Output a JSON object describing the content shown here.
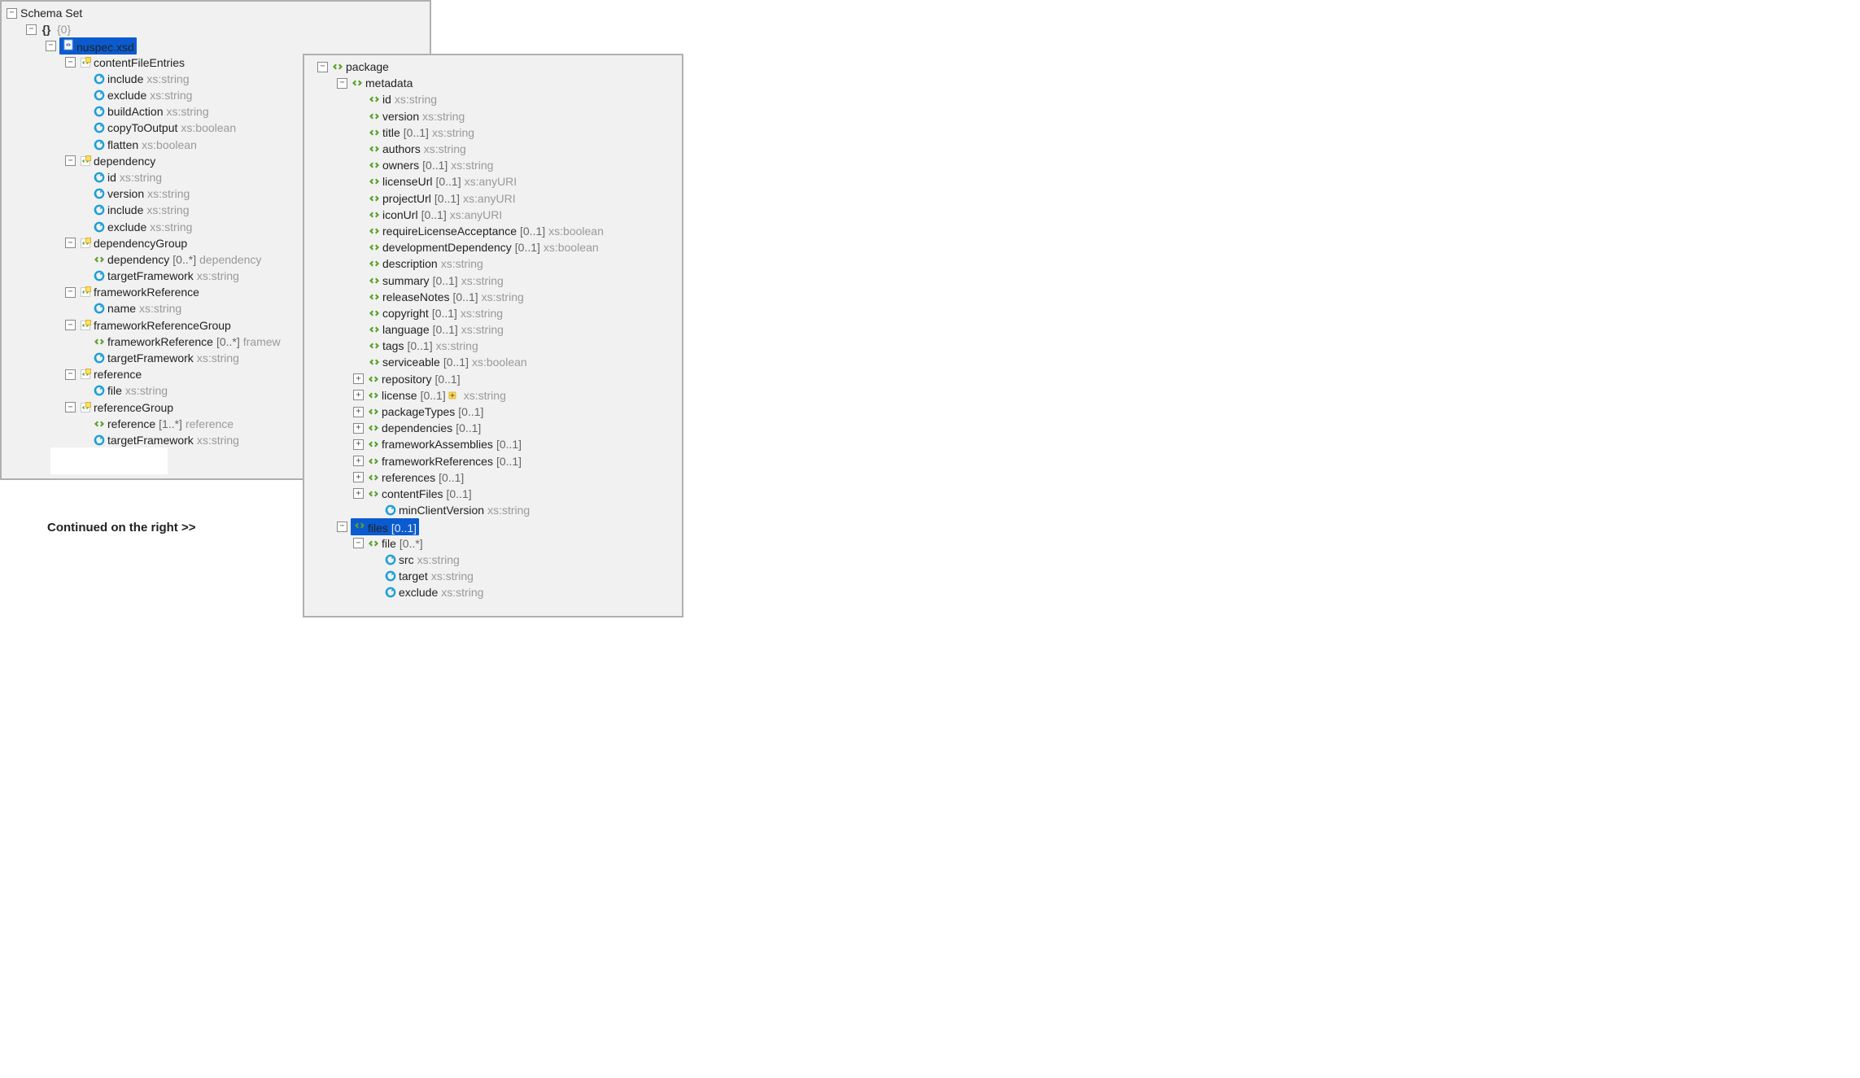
{
  "continued_label": "Continued on the right >>",
  "left": {
    "root": "Schema Set",
    "ns": "{0}",
    "file": "nuspec.xsd",
    "types": [
      {
        "name": "contentFileEntries",
        "attrs": [
          {
            "name": "include",
            "type": "xs:string"
          },
          {
            "name": "exclude",
            "type": "xs:string"
          },
          {
            "name": "buildAction",
            "type": "xs:string"
          },
          {
            "name": "copyToOutput",
            "type": "xs:boolean"
          },
          {
            "name": "flatten",
            "type": "xs:boolean"
          }
        ]
      },
      {
        "name": "dependency",
        "attrs": [
          {
            "name": "id",
            "type": "xs:string"
          },
          {
            "name": "version",
            "type": "xs:string"
          },
          {
            "name": "include",
            "type": "xs:string"
          },
          {
            "name": "exclude",
            "type": "xs:string"
          }
        ]
      },
      {
        "name": "dependencyGroup",
        "children": [
          {
            "kind": "elem",
            "name": "dependency",
            "occ": "[0..*]",
            "type": "dependency"
          },
          {
            "kind": "attr",
            "name": "targetFramework",
            "type": "xs:string"
          }
        ]
      },
      {
        "name": "frameworkReference",
        "attrs": [
          {
            "name": "name",
            "type": "xs:string"
          }
        ]
      },
      {
        "name": "frameworkReferenceGroup",
        "children": [
          {
            "kind": "elem",
            "name": "frameworkReference",
            "occ": "[0..*]",
            "type": "framew"
          },
          {
            "kind": "attr",
            "name": "targetFramework",
            "type": "xs:string"
          }
        ]
      },
      {
        "name": "reference",
        "attrs": [
          {
            "name": "file",
            "type": "xs:string"
          }
        ]
      },
      {
        "name": "referenceGroup",
        "children": [
          {
            "kind": "elem",
            "name": "reference",
            "occ": "[1..*]",
            "type": "reference"
          },
          {
            "kind": "attr",
            "name": "targetFramework",
            "type": "xs:string"
          }
        ]
      }
    ]
  },
  "right": {
    "package": "package",
    "metadata": "metadata",
    "meta_elems": [
      {
        "name": "id",
        "type": "xs:string"
      },
      {
        "name": "version",
        "type": "xs:string"
      },
      {
        "name": "title",
        "occ": "[0..1]",
        "type": "xs:string"
      },
      {
        "name": "authors",
        "type": "xs:string"
      },
      {
        "name": "owners",
        "occ": "[0..1]",
        "type": "xs:string"
      },
      {
        "name": "licenseUrl",
        "occ": "[0..1]",
        "type": "xs:anyURI"
      },
      {
        "name": "projectUrl",
        "occ": "[0..1]",
        "type": "xs:anyURI"
      },
      {
        "name": "iconUrl",
        "occ": "[0..1]",
        "type": "xs:anyURI"
      },
      {
        "name": "requireLicenseAcceptance",
        "occ": "[0..1]",
        "type": "xs:boolean"
      },
      {
        "name": "developmentDependency",
        "occ": "[0..1]",
        "type": "xs:boolean"
      },
      {
        "name": "description",
        "type": "xs:string"
      },
      {
        "name": "summary",
        "occ": "[0..1]",
        "type": "xs:string"
      },
      {
        "name": "releaseNotes",
        "occ": "[0..1]",
        "type": "xs:string"
      },
      {
        "name": "copyright",
        "occ": "[0..1]",
        "type": "xs:string"
      },
      {
        "name": "language",
        "occ": "[0..1]",
        "type": "xs:string"
      },
      {
        "name": "tags",
        "occ": "[0..1]",
        "type": "xs:string"
      },
      {
        "name": "serviceable",
        "occ": "[0..1]",
        "type": "xs:boolean"
      }
    ],
    "meta_collapsed": [
      {
        "name": "repository",
        "occ": "[0..1]"
      },
      {
        "name": "license",
        "occ": "[0..1]",
        "type": "xs:string",
        "plus": true
      },
      {
        "name": "packageTypes",
        "occ": "[0..1]"
      },
      {
        "name": "dependencies",
        "occ": "[0..1]"
      },
      {
        "name": "frameworkAssemblies",
        "occ": "[0..1]"
      },
      {
        "name": "frameworkReferences",
        "occ": "[0..1]"
      },
      {
        "name": "references",
        "occ": "[0..1]"
      },
      {
        "name": "contentFiles",
        "occ": "[0..1]"
      }
    ],
    "minClient": {
      "name": "minClientVersion",
      "type": "xs:string"
    },
    "files": {
      "name": "files",
      "occ": "[0..1]"
    },
    "file": {
      "name": "file",
      "occ": "[0..*]"
    },
    "file_attrs": [
      {
        "name": "src",
        "type": "xs:string"
      },
      {
        "name": "target",
        "type": "xs:string"
      },
      {
        "name": "exclude",
        "type": "xs:string"
      }
    ]
  }
}
